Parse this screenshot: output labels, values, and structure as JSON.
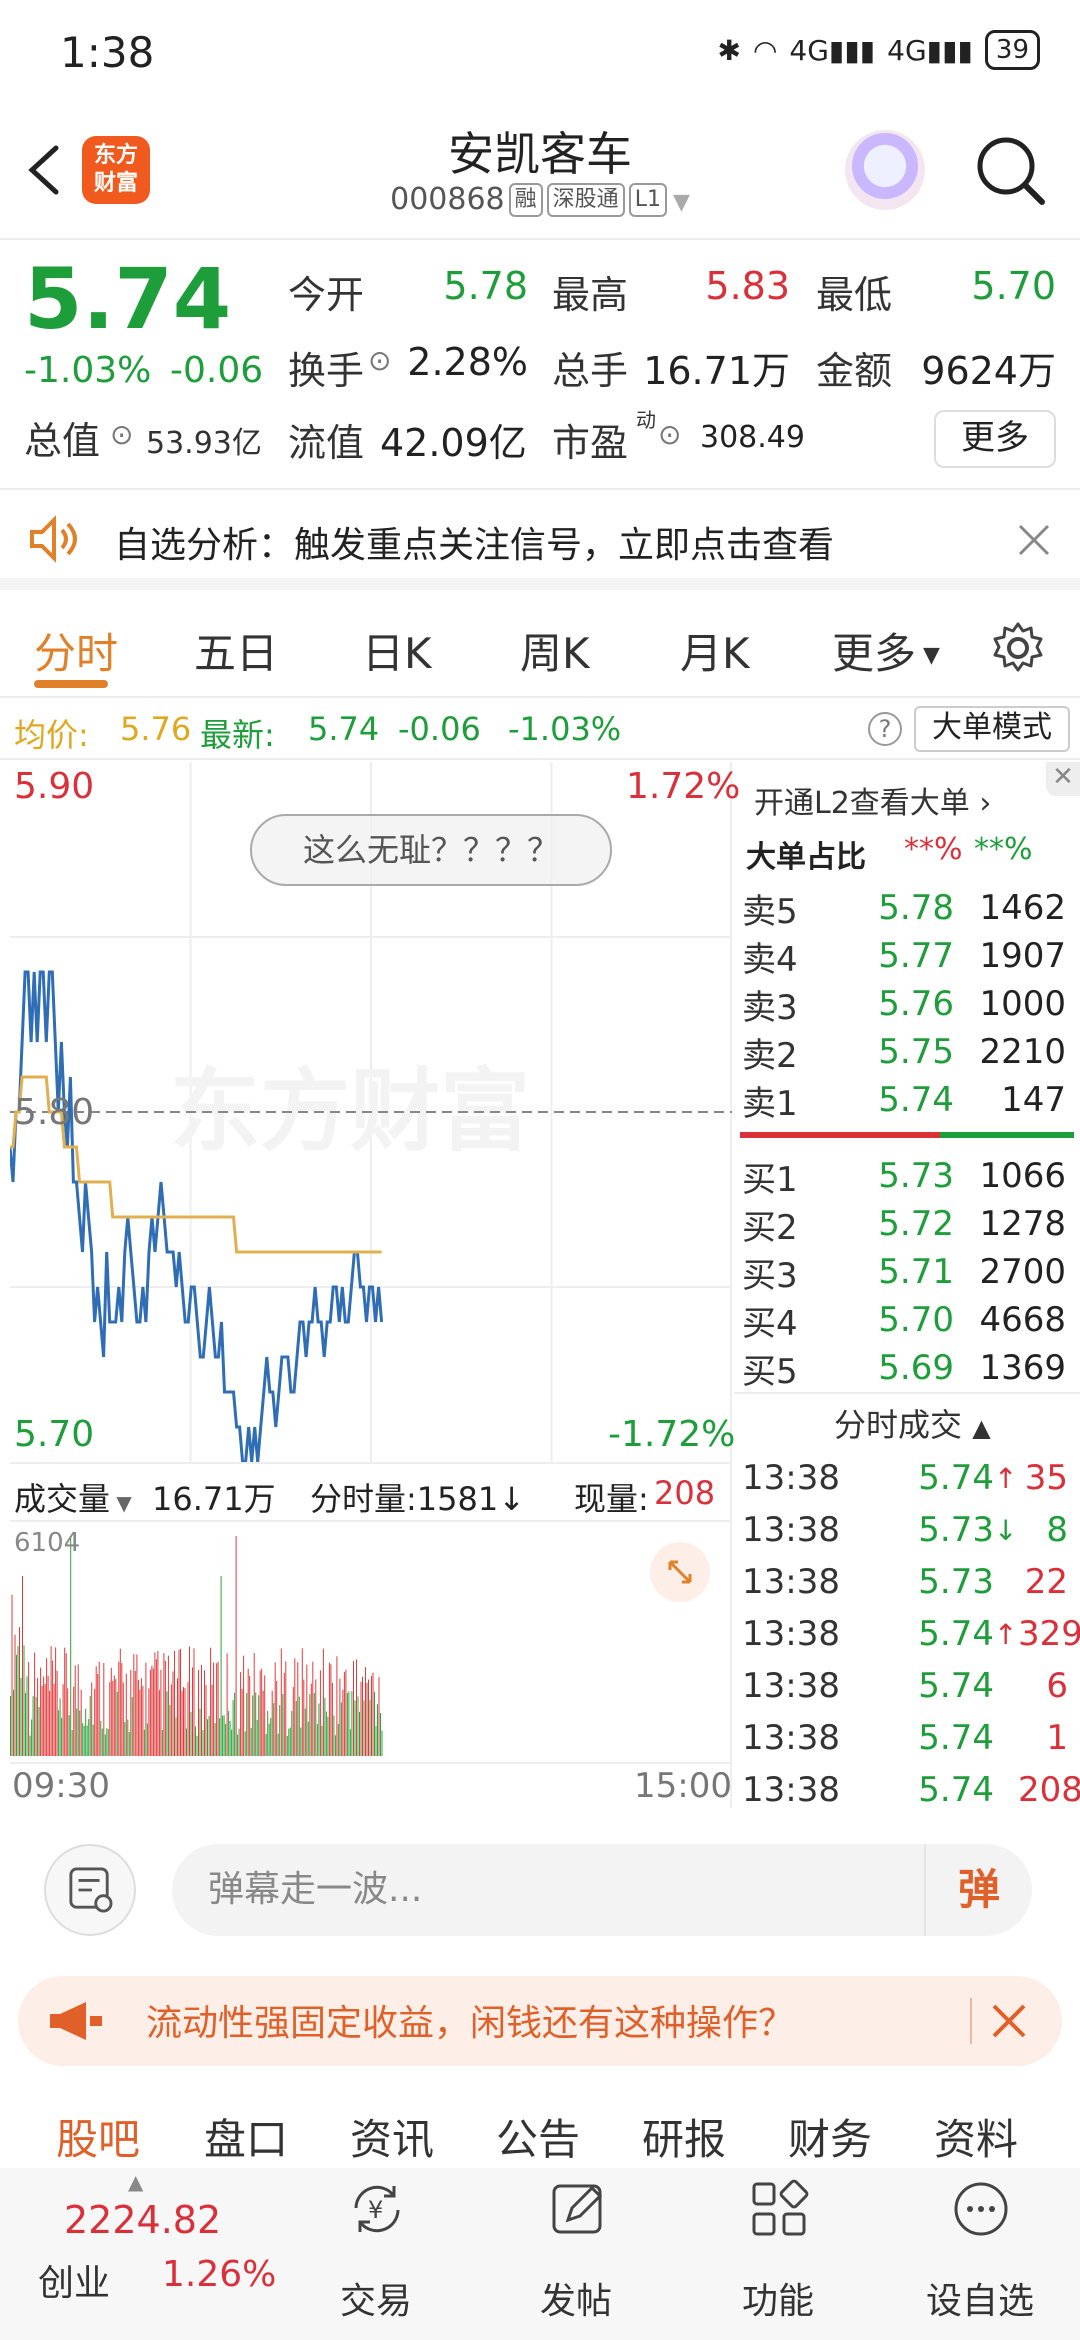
{
  "status_bar": {
    "time": "1:38",
    "network": "4G",
    "network2": "4G",
    "battery": "39"
  },
  "header": {
    "stock_name": "安凯客车",
    "stock_code": "000868",
    "tags": [
      "融",
      "深股通",
      "L1"
    ],
    "logo_text_1": "东方",
    "logo_text_2": "财富"
  },
  "quote": {
    "last_price": "5.74",
    "change_pct": "-1.03%",
    "change_val": "-0.06",
    "open_label": "今开",
    "open": "5.78",
    "high_label": "最高",
    "high": "5.83",
    "low_label": "最低",
    "low": "5.70",
    "turnover_label": "换手",
    "turnover": "2.28%",
    "volume_label": "总手",
    "volume": "16.71万",
    "amount_label": "金额",
    "amount": "9624万",
    "mktcap_label": "总值",
    "mktcap": "53.93亿",
    "float_label": "流值",
    "float": "42.09亿",
    "pe_label": "市盈",
    "pe_sup": "动",
    "pe": "308.49",
    "more_label": "更多"
  },
  "alert": {
    "text": "自选分析：触发重点关注信号，立即点击查看"
  },
  "tabs": [
    "分时",
    "五日",
    "日K",
    "周K",
    "月K",
    "更多"
  ],
  "avg_row": {
    "avg_label": "均价:",
    "avg": "5.76",
    "latest_label": "最新:",
    "latest": "5.74",
    "latest_chg": "-0.06",
    "latest_pct": "-1.03%",
    "bigorder_label": "大单模式"
  },
  "chart": {
    "price_top": "5.90",
    "price_mid": "5.80",
    "price_bottom": "5.70",
    "pct_top": "1.72%",
    "pct_bottom": "-1.72%",
    "comment": "这么无耻？？？？",
    "watermark": "东方财富",
    "vol_label": "成交量",
    "vol_total": "16.71万",
    "vol_tick_label": "分时量:1581↓",
    "vol_now_label": "现量:",
    "vol_now": "208",
    "vol_max": "6104",
    "time_start": "09:30",
    "time_end": "15:00"
  },
  "chart_data": {
    "type": "line",
    "ylim": [
      5.7,
      5.9
    ],
    "series": [
      {
        "values": [
          5.79,
          5.78,
          5.8,
          5.8,
          5.82,
          5.84,
          5.84,
          5.82,
          5.84,
          5.82,
          5.84,
          5.84,
          5.82,
          5.84,
          5.84,
          5.82,
          5.8,
          5.82,
          5.8,
          5.79,
          5.81,
          5.78,
          5.78,
          5.77,
          5.76,
          5.78,
          5.77,
          5.76,
          5.74,
          5.75,
          5.74,
          5.73,
          5.76,
          5.74,
          5.74,
          5.74,
          5.75,
          5.74,
          5.76,
          5.77,
          5.76,
          5.75,
          5.74,
          5.74,
          5.75,
          5.74,
          5.76,
          5.77,
          5.76,
          5.77,
          5.78,
          5.77,
          5.76,
          5.76,
          5.76,
          5.75,
          5.76,
          5.75,
          5.74,
          5.74,
          5.75,
          5.75,
          5.74,
          5.73,
          5.73,
          5.74,
          5.75,
          5.74,
          5.73,
          5.73,
          5.74,
          5.72,
          5.72,
          5.72,
          5.72,
          5.71,
          5.71,
          5.7,
          5.7,
          5.71,
          5.7,
          5.71,
          5.7,
          5.71,
          5.72,
          5.73,
          5.72,
          5.72,
          5.71,
          5.72,
          5.73,
          5.73,
          5.73,
          5.72,
          5.72,
          5.73,
          5.74,
          5.74,
          5.73,
          5.74,
          5.74,
          5.75,
          5.74,
          5.74,
          5.73,
          5.74,
          5.74,
          5.75,
          5.75,
          5.74,
          5.75,
          5.74,
          5.74,
          5.75,
          5.76,
          5.76,
          5.75,
          5.75,
          5.74,
          5.75,
          5.75,
          5.74,
          5.75,
          5.74
        ]
      },
      {
        "values": [
          5.79,
          5.79,
          5.8,
          5.8,
          5.81,
          5.81,
          5.81,
          5.81,
          5.81,
          5.81,
          5.81,
          5.81,
          5.81,
          5.8,
          5.8,
          5.8,
          5.8,
          5.8,
          5.79,
          5.79,
          5.79,
          5.79,
          5.79,
          5.78,
          5.78,
          5.78,
          5.78,
          5.78,
          5.78,
          5.78,
          5.78,
          5.78,
          5.78,
          5.78,
          5.77,
          5.77,
          5.77,
          5.77,
          5.77,
          5.77,
          5.77,
          5.77,
          5.77,
          5.77,
          5.77,
          5.77,
          5.77,
          5.77,
          5.77,
          5.77,
          5.77,
          5.77,
          5.77,
          5.77,
          5.77,
          5.77,
          5.77,
          5.77,
          5.77,
          5.77,
          5.77,
          5.77,
          5.77,
          5.77,
          5.77,
          5.77,
          5.77,
          5.77,
          5.77,
          5.77,
          5.77,
          5.77,
          5.77,
          5.77,
          5.77,
          5.76,
          5.76,
          5.76,
          5.76,
          5.76,
          5.76,
          5.76,
          5.76,
          5.76,
          5.76,
          5.76,
          5.76,
          5.76,
          5.76,
          5.76,
          5.76,
          5.76,
          5.76,
          5.76,
          5.76,
          5.76,
          5.76,
          5.76,
          5.76,
          5.76,
          5.76,
          5.76,
          5.76,
          5.76,
          5.76,
          5.76,
          5.76,
          5.76,
          5.76,
          5.76,
          5.76,
          5.76,
          5.76,
          5.76,
          5.76,
          5.76,
          5.76,
          5.76,
          5.76,
          5.76,
          5.76,
          5.76,
          5.76,
          5.76
        ]
      }
    ]
  },
  "orderbook": {
    "l2_label": "开通L2查看大单",
    "bigorder_ratio_label": "大单占比",
    "red_pct": "**%",
    "green_pct": "**%",
    "sells": [
      {
        "label": "卖5",
        "price": "5.78",
        "vol": "1462"
      },
      {
        "label": "卖4",
        "price": "5.77",
        "vol": "1907"
      },
      {
        "label": "卖3",
        "price": "5.76",
        "vol": "1000"
      },
      {
        "label": "卖2",
        "price": "5.75",
        "vol": "2210"
      },
      {
        "label": "卖1",
        "price": "5.74",
        "vol": "147"
      }
    ],
    "buys": [
      {
        "label": "买1",
        "price": "5.73",
        "vol": "1066"
      },
      {
        "label": "买2",
        "price": "5.72",
        "vol": "1278"
      },
      {
        "label": "买3",
        "price": "5.71",
        "vol": "2700"
      },
      {
        "label": "买4",
        "price": "5.70",
        "vol": "4668"
      },
      {
        "label": "买5",
        "price": "5.69",
        "vol": "1369"
      }
    ],
    "ticks_label": "分时成交",
    "ticks": [
      {
        "time": "13:38",
        "price": "5.74",
        "arrow": "↑",
        "vol": "35"
      },
      {
        "time": "13:38",
        "price": "5.73",
        "arrow": "↓",
        "vol": "8"
      },
      {
        "time": "13:38",
        "price": "5.73",
        "arrow": "",
        "vol": "22"
      },
      {
        "time": "13:38",
        "price": "5.74",
        "arrow": "↑",
        "vol": "329"
      },
      {
        "time": "13:38",
        "price": "5.74",
        "arrow": "",
        "vol": "6"
      },
      {
        "time": "13:38",
        "price": "5.74",
        "arrow": "",
        "vol": "1"
      },
      {
        "time": "13:38",
        "price": "5.74",
        "arrow": "",
        "vol": "208"
      }
    ]
  },
  "danmu": {
    "placeholder": "弹幕走一波...",
    "send_label": "弹"
  },
  "promo": {
    "text": "流动性强固定收益，闲钱还有这种操作？"
  },
  "bottom_tabs": [
    "股吧",
    "盘口",
    "资讯",
    "公告",
    "研报",
    "财务",
    "资料"
  ],
  "bottom_nav": {
    "index_value": "2224.82",
    "index_name": "创业",
    "index_pct": "1.26%",
    "items": [
      "交易",
      "发帖",
      "功能",
      "设自选"
    ]
  }
}
